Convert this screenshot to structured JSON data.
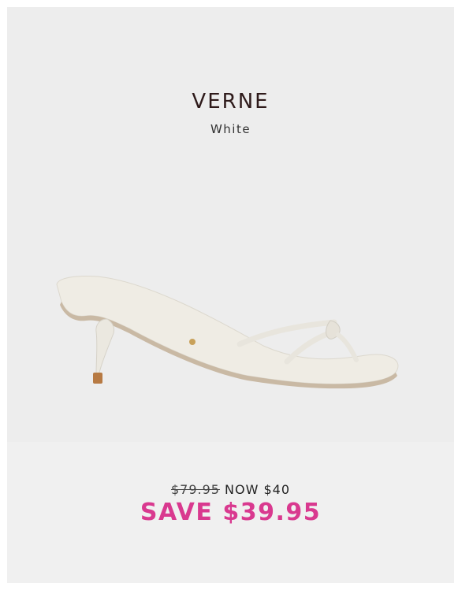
{
  "product": {
    "name": "VERNE",
    "color": "White",
    "image_icon": "white-kitten-heel-sandal-icon"
  },
  "pricing": {
    "original_price": "$79.95",
    "now_text": "NOW $40",
    "save_text": "SAVE $39.95",
    "accent_color": "#d9398f"
  }
}
